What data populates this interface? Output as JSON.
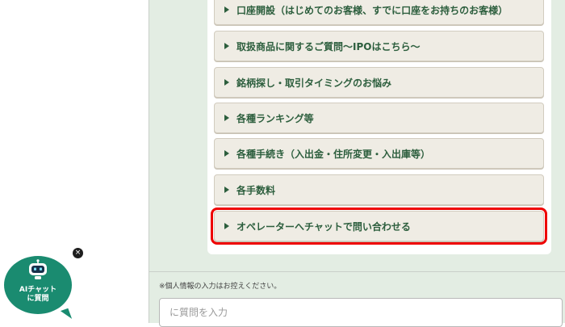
{
  "menu": {
    "items": [
      {
        "label": "口座開設（はじめてのお客様、すでに口座をお持ちのお客様）"
      },
      {
        "label": "取扱商品に関するご質問～IPOはこちら～"
      },
      {
        "label": "銘柄探し・取引タイミングのお悩み"
      },
      {
        "label": "各種ランキング等"
      },
      {
        "label": "各種手続き（入出金・住所変更・入出庫等）"
      },
      {
        "label": "各手数料"
      },
      {
        "label": "オペレーターへチャットで問い合わせる",
        "highlighted": true
      }
    ]
  },
  "notice": "※個人情報の入力はお控えください。",
  "input": {
    "placeholder": "に質問を入力",
    "value": ""
  },
  "bot_button": {
    "line1": "AIチャット",
    "line2": "に質問",
    "icon": "robot-icon"
  },
  "close_button": {
    "label": "×",
    "icon": "close-icon"
  },
  "colors": {
    "accent": "#2c5e3d",
    "highlight": "#ee0000",
    "bot": "#1a8b70",
    "panel": "#e3ede3"
  }
}
